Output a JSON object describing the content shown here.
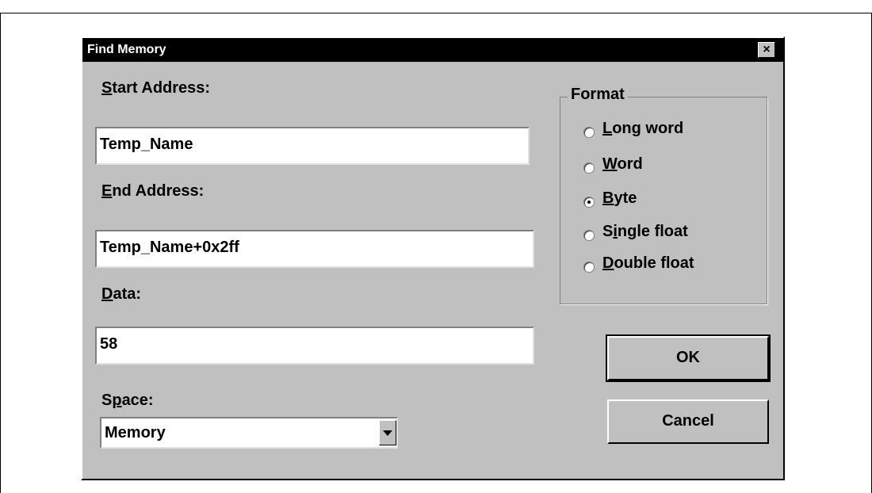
{
  "dialog": {
    "title": "Find Memory",
    "close_glyph": "×"
  },
  "start_address": {
    "label_mnemonic": "S",
    "label_rest": "tart Address:",
    "value": "Temp_Name"
  },
  "end_address": {
    "label_mnemonic": "E",
    "label_rest": "nd Address:",
    "value": "Temp_Name+0x2ff"
  },
  "data": {
    "label_mnemonic": "D",
    "label_rest": "ata:",
    "value": "58"
  },
  "space": {
    "label_pre": "S",
    "label_mnemonic": "p",
    "label_rest": "ace:",
    "selected": "Memory"
  },
  "format": {
    "label": "Format",
    "options": [
      {
        "pre": "",
        "mnemonic": "L",
        "rest": "ong word",
        "selected": false
      },
      {
        "pre": "",
        "mnemonic": "W",
        "rest": "ord",
        "selected": false
      },
      {
        "pre": "",
        "mnemonic": "B",
        "rest": "yte",
        "selected": true
      },
      {
        "pre": "S",
        "mnemonic": "i",
        "rest": "ngle float",
        "selected": false
      },
      {
        "pre": "",
        "mnemonic": "D",
        "rest": "ouble float",
        "selected": false
      }
    ]
  },
  "buttons": {
    "ok": "OK",
    "cancel": "Cancel"
  }
}
